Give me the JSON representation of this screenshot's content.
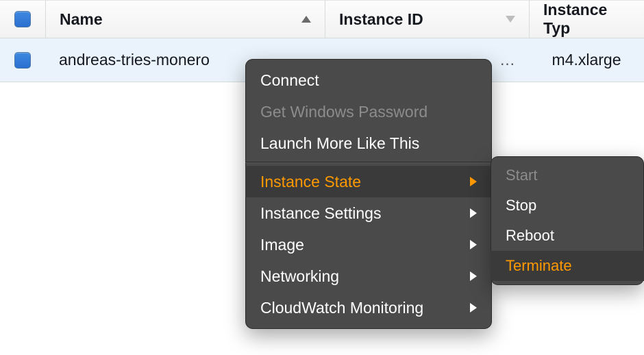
{
  "columns": {
    "name": "Name",
    "instance_id": "Instance ID",
    "instance_type": "Instance Typ"
  },
  "row": {
    "name": "andreas-tries-monero",
    "instance_id_display": "…",
    "instance_type": "m4.xlarge"
  },
  "context_menu": {
    "connect": "Connect",
    "get_windows_password": "Get Windows Password",
    "launch_more": "Launch More Like This",
    "instance_state": "Instance State",
    "instance_settings": "Instance Settings",
    "image": "Image",
    "networking": "Networking",
    "cloudwatch": "CloudWatch Monitoring"
  },
  "instance_state_submenu": {
    "start": "Start",
    "stop": "Stop",
    "reboot": "Reboot",
    "terminate": "Terminate"
  }
}
